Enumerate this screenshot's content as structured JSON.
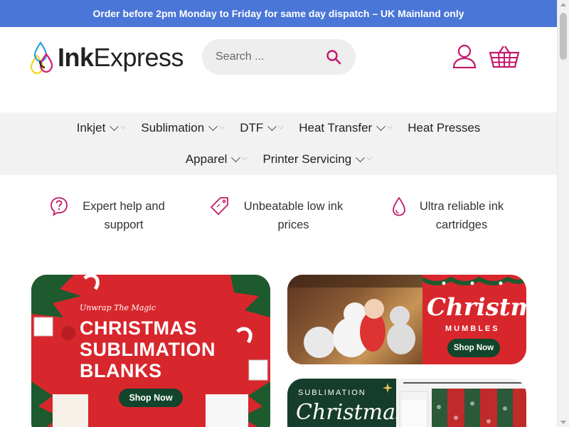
{
  "announcement": "Order before 2pm Monday to Friday for same day dispatch – UK Mainland only",
  "brand": {
    "bold": "Ink",
    "light": "Express"
  },
  "search": {
    "placeholder": "Search ..."
  },
  "colors": {
    "accent": "#c2186b",
    "topbar": "#4a76d7",
    "nav_bg": "#f2f2f2",
    "banner_red": "#d8262d",
    "button_green": "#12452c"
  },
  "nav": {
    "row1": [
      "Inkjet",
      "Sublimation",
      "DTF",
      "Heat Transfer",
      "Heat Presses"
    ],
    "row2": [
      "Apparel",
      "Printer Servicing"
    ]
  },
  "usps": [
    {
      "icon": "question-circle-icon",
      "line1": "Expert help and",
      "line2": "support"
    },
    {
      "icon": "price-tag-icon",
      "line1": "Unbeatable low ink",
      "line2": "prices"
    },
    {
      "icon": "ink-drop-icon",
      "line1": "Ultra reliable ink",
      "line2": "cartridges"
    }
  ],
  "banners": {
    "blanks": {
      "tagline": "Unwrap The Magic",
      "line1": "CHRISTMAS",
      "line2": "SUBLIMATION",
      "line3": "BLANKS",
      "button": "Shop Now"
    },
    "mumbles": {
      "title": "Christmas",
      "subtitle": "MUMBLES",
      "button": "Shop Now"
    },
    "sublimation_christmas": {
      "subtitle": "SUBLIMATION",
      "title": "Christmas"
    }
  }
}
